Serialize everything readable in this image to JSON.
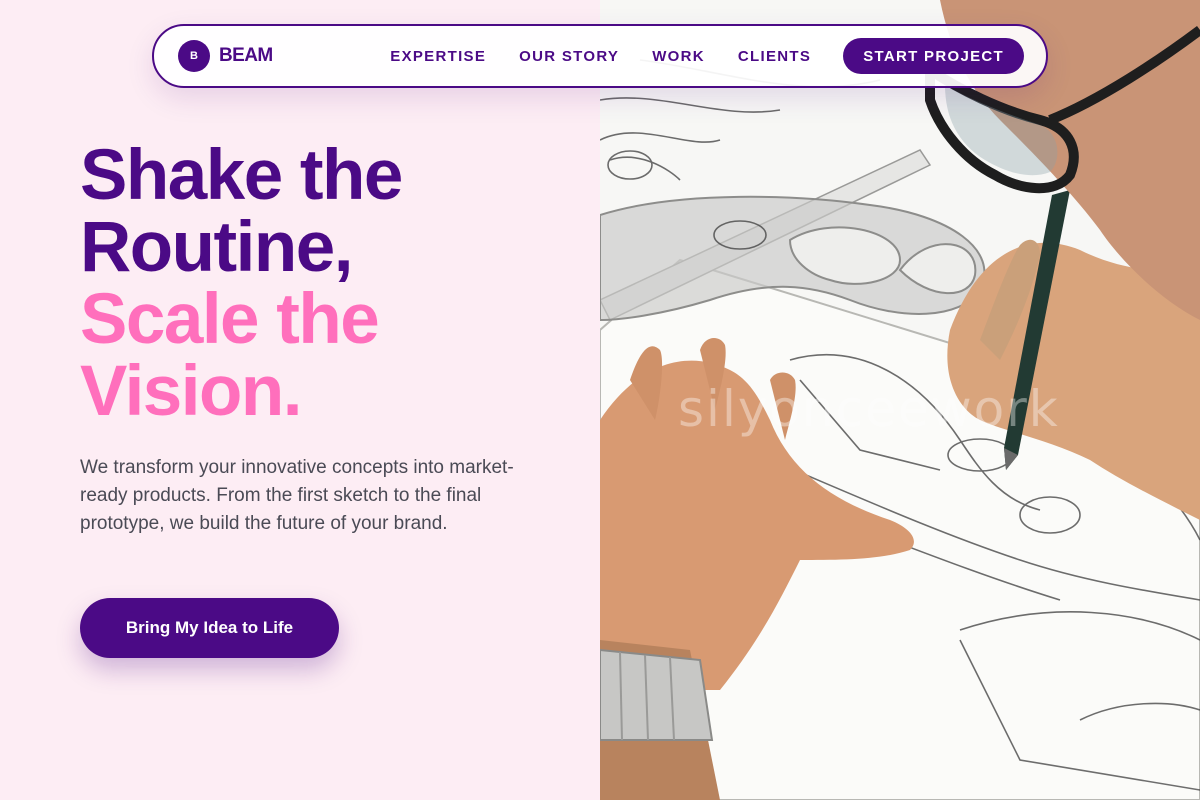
{
  "brand": {
    "mark": "B",
    "name": "BEAM"
  },
  "nav": {
    "links": [
      "EXPERTISE",
      "OUR STORY",
      "WORK",
      "CLIENTS"
    ],
    "cta": "START PROJECT"
  },
  "hero": {
    "title_line1": "Shake the",
    "title_line2": "Routine,",
    "title_line3": "Scale the",
    "title_line4": "Vision.",
    "description": "We transform your innovative concepts into market-ready products. From the first sketch to the final prototype, we build the future of your brand.",
    "cta": "Bring My Idea to Life"
  },
  "image": {
    "watermark": "silyonceework"
  },
  "colors": {
    "primary": "#4b0a86",
    "accent": "#ff6fbc",
    "background": "#fdedf4"
  }
}
